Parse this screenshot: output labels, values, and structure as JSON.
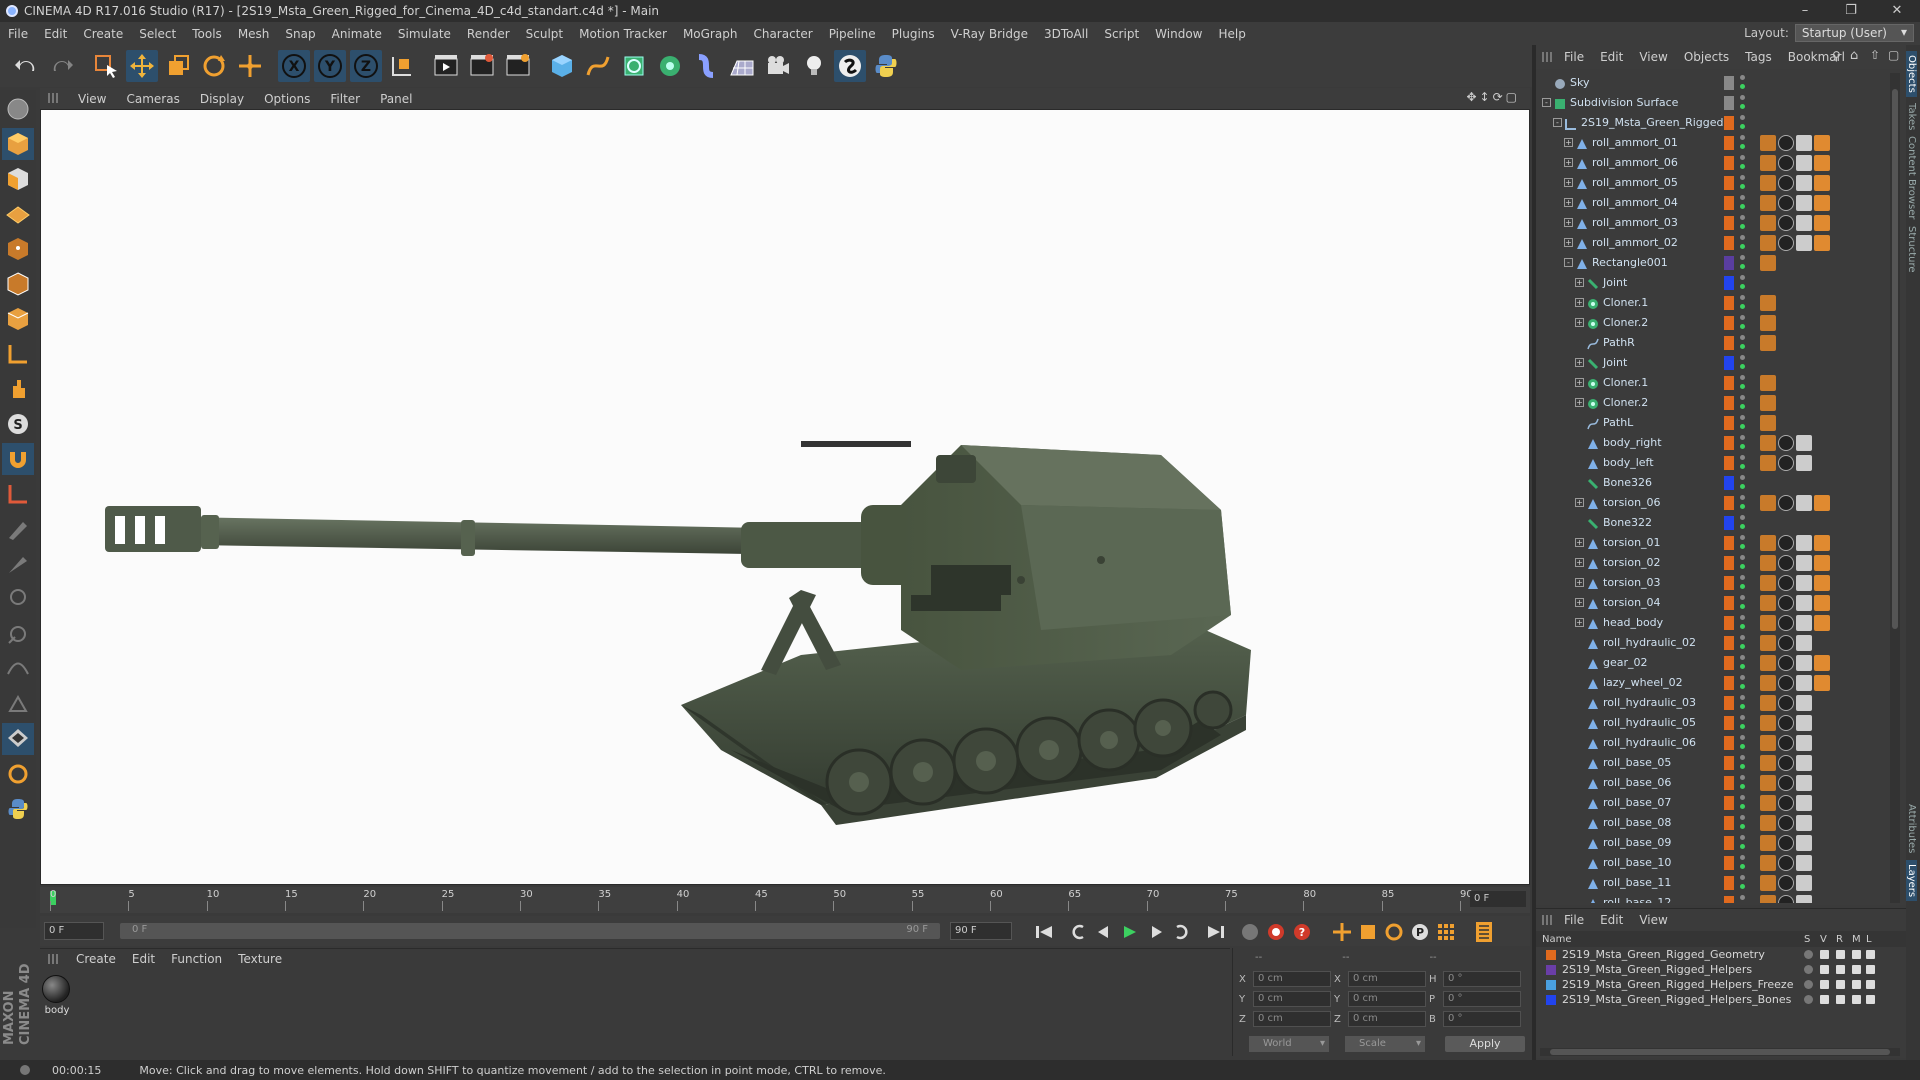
{
  "window": {
    "title": "CINEMA 4D R17.016 Studio (R17) - [2S19_Msta_Green_Rigged_for_Cinema_4D_c4d_standart.c4d *] - Main"
  },
  "menubar": {
    "items": [
      "File",
      "Edit",
      "Create",
      "Select",
      "Tools",
      "Mesh",
      "Snap",
      "Animate",
      "Simulate",
      "Render",
      "Sculpt",
      "Motion Tracker",
      "MoGraph",
      "Character",
      "Pipeline",
      "Plugins",
      "V-Ray Bridge",
      "3DToAll",
      "Script",
      "Window",
      "Help"
    ],
    "layout_label": "Layout:",
    "layout_value": "Startup (User)"
  },
  "viewport_menu": [
    "View",
    "Cameras",
    "Display",
    "Options",
    "Filter",
    "Panel"
  ],
  "timeline": {
    "ticks": [
      "0",
      "5",
      "10",
      "15",
      "20",
      "25",
      "30",
      "35",
      "40",
      "45",
      "50",
      "55",
      "60",
      "65",
      "70",
      "75",
      "80",
      "85",
      "90"
    ],
    "current_frame": "0 F"
  },
  "playback": {
    "start": "0 F",
    "slider_start": "0 F",
    "slider_end": "90 F",
    "end": "90 F"
  },
  "material_menu": [
    "Create",
    "Edit",
    "Function",
    "Texture"
  ],
  "materials": [
    {
      "name": "body"
    }
  ],
  "coords": {
    "rows": [
      {
        "a": "X",
        "av": "0 cm",
        "b": "X",
        "bv": "0 cm",
        "c": "H",
        "cv": "0 °"
      },
      {
        "a": "Y",
        "av": "0 cm",
        "b": "Y",
        "bv": "0 cm",
        "c": "P",
        "cv": "0 °"
      },
      {
        "a": "Z",
        "av": "0 cm",
        "b": "Z",
        "bv": "0 cm",
        "c": "B",
        "cv": "0 °"
      }
    ],
    "header_dashes": [
      "--",
      "--",
      "--"
    ],
    "mode": "World",
    "type": "Scale",
    "apply": "Apply"
  },
  "objects_menu": [
    "File",
    "Edit",
    "View",
    "Objects",
    "Tags",
    "Bookmarl"
  ],
  "objects": [
    {
      "name": "Sky",
      "indent": 0,
      "icon": "sky",
      "color": "#888"
    },
    {
      "name": "Subdivision Surface",
      "indent": 0,
      "icon": "subd",
      "color": "#888",
      "exp": "-"
    },
    {
      "name": "2S19_Msta_Green_Rigged",
      "indent": 1,
      "icon": "null",
      "color": "#e06a1e",
      "exp": "-"
    },
    {
      "name": "roll_ammort_01",
      "indent": 2,
      "icon": "joint",
      "color": "#e06a1e",
      "exp": "+",
      "tags": 4
    },
    {
      "name": "roll_ammort_06",
      "indent": 2,
      "icon": "joint",
      "color": "#e06a1e",
      "exp": "+",
      "tags": 4
    },
    {
      "name": "roll_ammort_05",
      "indent": 2,
      "icon": "joint",
      "color": "#e06a1e",
      "exp": "+",
      "tags": 4
    },
    {
      "name": "roll_ammort_04",
      "indent": 2,
      "icon": "joint",
      "color": "#e06a1e",
      "exp": "+",
      "tags": 4
    },
    {
      "name": "roll_ammort_03",
      "indent": 2,
      "icon": "joint",
      "color": "#e06a1e",
      "exp": "+",
      "tags": 4
    },
    {
      "name": "roll_ammort_02",
      "indent": 2,
      "icon": "joint",
      "color": "#e06a1e",
      "exp": "+",
      "tags": 4
    },
    {
      "name": "Rectangle001",
      "indent": 2,
      "icon": "joint",
      "color": "#5a3ea0",
      "exp": "-",
      "tags": 1
    },
    {
      "name": "Joint",
      "indent": 3,
      "icon": "bone",
      "color": "#2244ee",
      "exp": "+"
    },
    {
      "name": "Cloner.1",
      "indent": 3,
      "icon": "cloner",
      "color": "#e06a1e",
      "exp": "+",
      "tags": 1
    },
    {
      "name": "Cloner.2",
      "indent": 3,
      "icon": "cloner",
      "color": "#e06a1e",
      "exp": "+",
      "tags": 1
    },
    {
      "name": "PathR",
      "indent": 3,
      "icon": "spline",
      "color": "#e06a1e",
      "tags": 1
    },
    {
      "name": "Joint",
      "indent": 3,
      "icon": "bone",
      "color": "#2244ee",
      "exp": "+"
    },
    {
      "name": "Cloner.1",
      "indent": 3,
      "icon": "cloner",
      "color": "#e06a1e",
      "exp": "+",
      "tags": 1
    },
    {
      "name": "Cloner.2",
      "indent": 3,
      "icon": "cloner",
      "color": "#e06a1e",
      "exp": "+",
      "tags": 1
    },
    {
      "name": "PathL",
      "indent": 3,
      "icon": "spline",
      "color": "#e06a1e",
      "tags": 1
    },
    {
      "name": "body_right",
      "indent": 3,
      "icon": "joint",
      "color": "#e06a1e",
      "tags": 3
    },
    {
      "name": "body_left",
      "indent": 3,
      "icon": "joint",
      "color": "#e06a1e",
      "tags": 3
    },
    {
      "name": "Bone326",
      "indent": 3,
      "icon": "bone",
      "color": "#2244ee"
    },
    {
      "name": "torsion_06",
      "indent": 3,
      "icon": "joint",
      "color": "#e06a1e",
      "exp": "+",
      "tags": 4
    },
    {
      "name": "Bone322",
      "indent": 3,
      "icon": "bone",
      "color": "#2244ee"
    },
    {
      "name": "torsion_01",
      "indent": 3,
      "icon": "joint",
      "color": "#e06a1e",
      "exp": "+",
      "tags": 4
    },
    {
      "name": "torsion_02",
      "indent": 3,
      "icon": "joint",
      "color": "#e06a1e",
      "exp": "+",
      "tags": 4
    },
    {
      "name": "torsion_03",
      "indent": 3,
      "icon": "joint",
      "color": "#e06a1e",
      "exp": "+",
      "tags": 4
    },
    {
      "name": "torsion_04",
      "indent": 3,
      "icon": "joint",
      "color": "#e06a1e",
      "exp": "+",
      "tags": 4
    },
    {
      "name": "head_body",
      "indent": 3,
      "icon": "joint",
      "color": "#e06a1e",
      "exp": "+",
      "tags": 4
    },
    {
      "name": "roll_hydraulic_02",
      "indent": 3,
      "icon": "joint",
      "color": "#e06a1e",
      "tags": 3
    },
    {
      "name": "gear_02",
      "indent": 3,
      "icon": "joint",
      "color": "#e06a1e",
      "tags": 4
    },
    {
      "name": "lazy_wheel_02",
      "indent": 3,
      "icon": "joint",
      "color": "#e06a1e",
      "tags": 4
    },
    {
      "name": "roll_hydraulic_03",
      "indent": 3,
      "icon": "joint",
      "color": "#e06a1e",
      "tags": 3
    },
    {
      "name": "roll_hydraulic_05",
      "indent": 3,
      "icon": "joint",
      "color": "#e06a1e",
      "tags": 3
    },
    {
      "name": "roll_hydraulic_06",
      "indent": 3,
      "icon": "joint",
      "color": "#e06a1e",
      "tags": 3
    },
    {
      "name": "roll_base_05",
      "indent": 3,
      "icon": "joint",
      "color": "#e06a1e",
      "tags": 3
    },
    {
      "name": "roll_base_06",
      "indent": 3,
      "icon": "joint",
      "color": "#e06a1e",
      "tags": 3
    },
    {
      "name": "roll_base_07",
      "indent": 3,
      "icon": "joint",
      "color": "#e06a1e",
      "tags": 3
    },
    {
      "name": "roll_base_08",
      "indent": 3,
      "icon": "joint",
      "color": "#e06a1e",
      "tags": 3
    },
    {
      "name": "roll_base_09",
      "indent": 3,
      "icon": "joint",
      "color": "#e06a1e",
      "tags": 3
    },
    {
      "name": "roll_base_10",
      "indent": 3,
      "icon": "joint",
      "color": "#e06a1e",
      "tags": 3
    },
    {
      "name": "roll_base_11",
      "indent": 3,
      "icon": "joint",
      "color": "#e06a1e",
      "tags": 3
    },
    {
      "name": "roll_base_12",
      "indent": 3,
      "icon": "joint",
      "color": "#e06a1e",
      "tags": 3
    }
  ],
  "layers_menu": [
    "File",
    "Edit",
    "View"
  ],
  "layers_header": {
    "name": "Name",
    "cols": [
      "S",
      "V",
      "R",
      "M",
      "L"
    ]
  },
  "layers": [
    {
      "name": "2S19_Msta_Green_Rigged_Geometry",
      "color": "#e06a1e"
    },
    {
      "name": "2S19_Msta_Green_Rigged_Helpers",
      "color": "#6a3ea8"
    },
    {
      "name": "2S19_Msta_Green_Rigged_Helpers_Freeze",
      "color": "#4aa0e0"
    },
    {
      "name": "2S19_Msta_Green_Rigged_Helpers_Bones",
      "color": "#2244ee"
    }
  ],
  "side_tabs": [
    "Objects",
    "Takes",
    "Content Browser",
    "Structure"
  ],
  "side_tabs_bottom": [
    "Attributes",
    "Layers"
  ],
  "status": {
    "time": "00:00:15",
    "message": "Move: Click and drag to move elements. Hold down SHIFT to quantize movement / add to the selection in point mode, CTRL to remove."
  },
  "colors": {
    "accent_blue": "#2d4f6c",
    "tank_green": "#4d5a47",
    "object_orange": "#e06a1e"
  }
}
